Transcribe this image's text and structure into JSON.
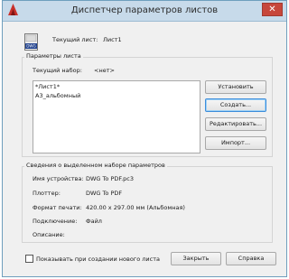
{
  "window": {
    "title": "Диспетчер параметров листов",
    "close_label": "✕"
  },
  "current_sheet": {
    "label": "Текущий лист:",
    "value": "Лист1",
    "icon_text": "DWG"
  },
  "page_setups": {
    "group_title": "Параметры листа",
    "current_set_label": "Текущий набор:",
    "current_set_value": "<нет>",
    "items": [
      "*Лист1*",
      "A3_альбомный"
    ]
  },
  "buttons": {
    "set_current": "Установить",
    "new": "Создать...",
    "modify": "Редактировать...",
    "import": "Импорт..."
  },
  "details": {
    "group_title": "Сведения о выделенном наборе параметров",
    "device_name_label": "Имя устройства:",
    "device_name_value": "DWG To PDF.pc3",
    "plotter_label": "Плоттер:",
    "plotter_value": "DWG To PDF",
    "plot_size_label": "Формат печати:",
    "plot_size_value": "420.00 x 297.00 мм (Альбомная)",
    "where_label": "Подключение:",
    "where_value": "Файл",
    "description_label": "Описание:",
    "description_value": ""
  },
  "footer": {
    "checkbox_label": "Показывать при создании нового листа",
    "close_button": "Закрыть",
    "help_button": "Справка"
  }
}
